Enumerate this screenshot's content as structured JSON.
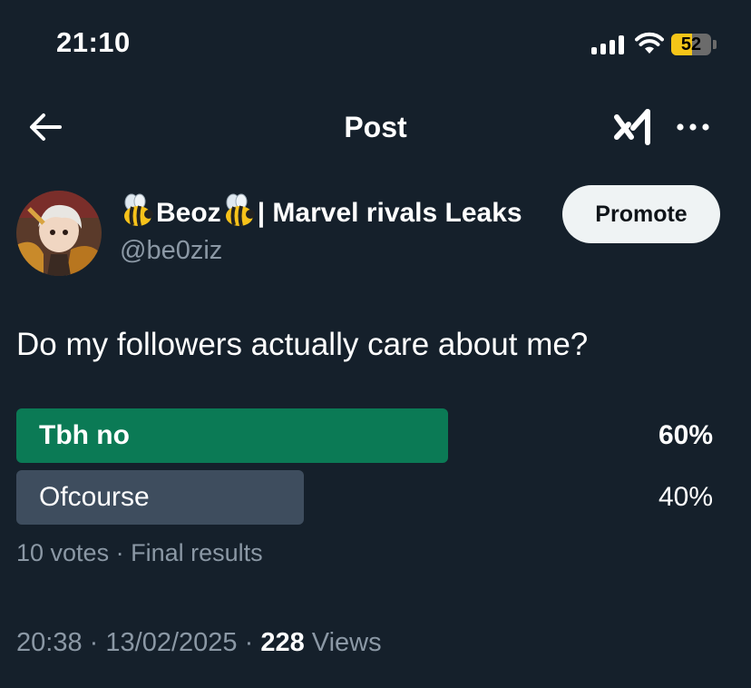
{
  "status_bar": {
    "time": "21:10",
    "battery_level": "52",
    "battery_fraction": 0.52,
    "icons": [
      "signal-icon",
      "wifi-icon",
      "battery-icon"
    ]
  },
  "header": {
    "title": "Post",
    "icons": [
      "back-arrow-icon",
      "grok-icon",
      "more-icon"
    ]
  },
  "author": {
    "bee_emoji": "🐝",
    "name_main": "Beoz",
    "name_suffix": "| Marvel rivals Leaks",
    "handle": "@be0ziz",
    "promote_label": "Promote"
  },
  "post": {
    "text": "Do my followers actually care about me?"
  },
  "poll": {
    "options": [
      {
        "label": "Tbh no",
        "percent": "60%",
        "fraction": 0.6,
        "winner": true
      },
      {
        "label": "Ofcourse",
        "percent": "40%",
        "fraction": 0.4,
        "winner": false
      }
    ],
    "votes": "10 votes",
    "separator": "·",
    "status": "Final results"
  },
  "meta": {
    "time": "20:38",
    "date": "13/02/2025",
    "separator": "·",
    "views_count": "228",
    "views_label": "Views"
  },
  "colors": {
    "background": "#15202b",
    "winner_bar": "#0b7a55",
    "loser_bar": "#3e4d5e",
    "muted_text": "#8b98a5",
    "battery": "#f5c518"
  }
}
